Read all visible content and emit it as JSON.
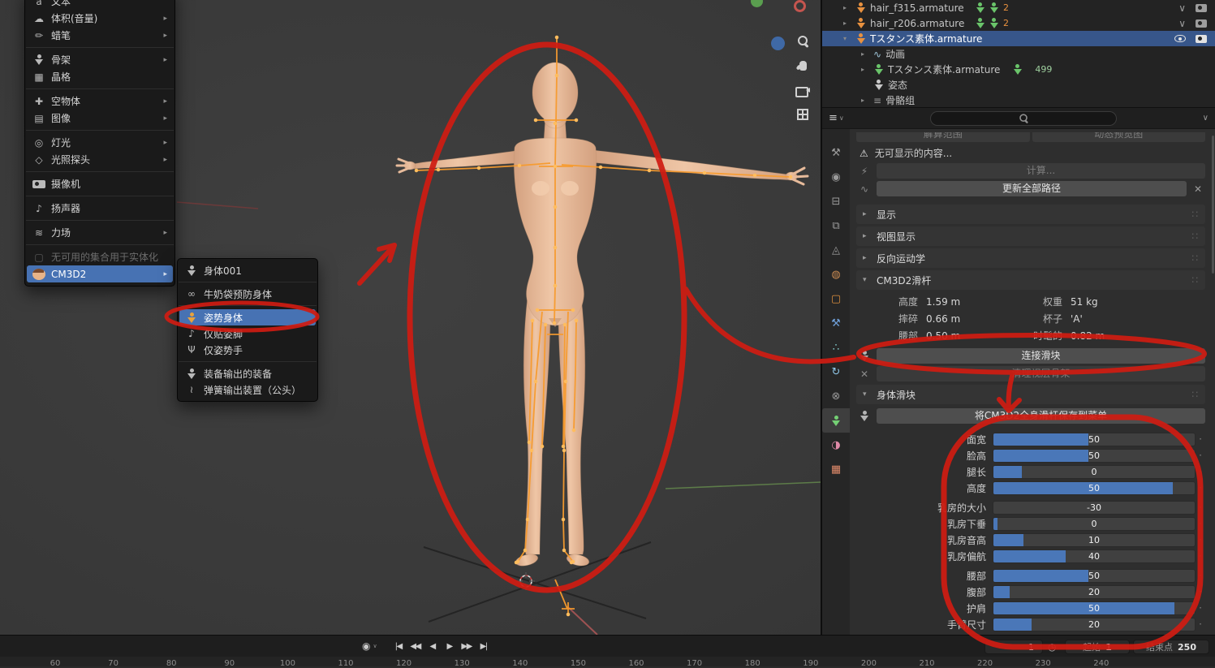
{
  "colors": {
    "accent": "#4772b3",
    "annotation": "#cf1c12",
    "armature": "#ffa133",
    "skin": "#eec3a4",
    "selected_row": "#37568a"
  },
  "add_menu": {
    "arrow_glyph": "▸",
    "items": [
      {
        "label": "文本",
        "icon": "text-icon",
        "glyph": "a"
      },
      {
        "label": "体积(音量)",
        "icon": "volume-icon",
        "glyph": "☁",
        "arrow": true
      },
      {
        "label": "蜡笔",
        "icon": "grease-pencil-icon",
        "glyph": "✏",
        "arrow": true,
        "sep": true
      },
      {
        "label": "骨架",
        "icon": "armature-icon",
        "glyph": "person",
        "arrow": true
      },
      {
        "label": "晶格",
        "icon": "lattice-icon",
        "glyph": "▦",
        "sep": true
      },
      {
        "label": "空物体",
        "icon": "empty-icon",
        "glyph": "✚",
        "arrow": true
      },
      {
        "label": "图像",
        "icon": "image-icon",
        "glyph": "▤",
        "arrow": true,
        "sep": true
      },
      {
        "label": "灯光",
        "icon": "light-icon",
        "glyph": "◎",
        "arrow": true
      },
      {
        "label": "光照探头",
        "icon": "light-probe-icon",
        "glyph": "◇",
        "arrow": true,
        "sep": true
      },
      {
        "label": "摄像机",
        "icon": "camera-icon",
        "glyph": "camera",
        "sep": true
      },
      {
        "label": "扬声器",
        "icon": "speaker-icon",
        "glyph": "♪",
        "sep": true
      },
      {
        "label": "力场",
        "icon": "force-field-icon",
        "glyph": "≋",
        "arrow": true,
        "sep": true
      },
      {
        "label": "无可用的集合用于实体化",
        "icon": "collection-icon",
        "glyph": "▢",
        "disabled": true
      },
      {
        "label": "CM3D2",
        "icon": "cm3d2-icon",
        "glyph": "face",
        "arrow": true,
        "highlighted": true
      }
    ]
  },
  "cm3d2_submenu": {
    "items": [
      {
        "label": "身体001",
        "icon": "body-icon",
        "glyph": "person",
        "sep": true
      },
      {
        "label": "牛奶袋预防身体",
        "icon": "milk-bag-body-icon",
        "glyph": "∞",
        "sep": true
      },
      {
        "label": "姿势身体",
        "icon": "pose-body-icon",
        "glyph": "person",
        "icon_color": "#e8a33d",
        "highlighted": true
      },
      {
        "label": "仅贴姿脚",
        "icon": "pose-feet-icon",
        "glyph": "♪"
      },
      {
        "label": "仅姿势手",
        "icon": "pose-hands-icon",
        "glyph": "Ψ",
        "sep": true
      },
      {
        "label": "装备输出的装备",
        "icon": "equipment-icon",
        "glyph": "person"
      },
      {
        "label": "弹簧输出装置（公头）",
        "icon": "spring-plug-icon",
        "glyph": "≀"
      }
    ]
  },
  "outliner": {
    "rows": [
      {
        "label": "hair_f315.armature",
        "caret": "▸",
        "icon": "armature",
        "mods": [
          "person",
          "person"
        ],
        "badge": "2",
        "right": [
          "chevron",
          "camera"
        ]
      },
      {
        "label": "hair_r206.armature",
        "caret": "▸",
        "icon": "armature",
        "mods": [
          "person",
          "person"
        ],
        "badge": "2",
        "right": [
          "chevron",
          "camera"
        ]
      },
      {
        "label": "Tスタンス素体.armature",
        "caret": "▾",
        "icon": "armature",
        "selected": true,
        "right": [
          "eye",
          "camera"
        ]
      },
      {
        "label": "动画",
        "caret": "▸",
        "icon": "anim",
        "indent": 1
      },
      {
        "label": "Tスタンス素体.armature",
        "caret": "▸",
        "icon": "person-green",
        "indent": 1,
        "count": "499"
      },
      {
        "label": "姿态",
        "caret": "",
        "icon": "pose",
        "indent": 1
      },
      {
        "label": "骨骼组",
        "caret": "▸",
        "icon": "group",
        "indent": 1
      }
    ]
  },
  "properties": {
    "header": {
      "editor_glyph": "≡",
      "chevron": "∨"
    },
    "icons": {
      "warning": "⚠",
      "calc": "⚡",
      "update": "∿",
      "close": "✕",
      "dots": "∷",
      "caret_closed": "▸",
      "caret_open": "▾",
      "connect": "person",
      "clean": "✕",
      "save": "person"
    },
    "range_left": "解算范围",
    "range_right": "动态预览图",
    "warning": "无可显示的内容...",
    "calc": "计算...",
    "update": "更新全部路径",
    "panel_display": "显示",
    "panel_viewport": "视图显示",
    "panel_ik": "反向运动学",
    "panel_cm3d2": "CM3D2滑杆",
    "panel_body": "身体滑块",
    "stats": {
      "r1l": "高度",
      "r1v": "1.59 m",
      "r1l2": "权重",
      "r1v2": "51 kg",
      "r2l": "摔碎",
      "r2v": "0.66 m",
      "r2l2": "杯子",
      "r2v2": "'A'",
      "r3l": "腰部",
      "r3v": "0.50 m",
      "r3l2": "时髦的",
      "r3v2": "0.82 m"
    },
    "connect": "连接滑块",
    "clean": "清理视层骨架",
    "save": "将CM3D2全身滑杆保存到菜单",
    "tabs": [
      {
        "name": "tool",
        "glyph": "⚒",
        "color": "#9a9a9a"
      },
      {
        "name": "render",
        "glyph": "◉",
        "color": "#9a9a9a"
      },
      {
        "name": "output",
        "glyph": "⊟",
        "color": "#9a9a9a"
      },
      {
        "name": "view-layer",
        "glyph": "⧉",
        "color": "#9a9a9a"
      },
      {
        "name": "scene",
        "glyph": "◬",
        "color": "#9a9a9a"
      },
      {
        "name": "world",
        "glyph": "◍",
        "color": "#c98a52"
      },
      {
        "name": "object",
        "glyph": "▢",
        "color": "#dd8f3e"
      },
      {
        "name": "modifiers",
        "glyph": "⚒",
        "color": "#6f9fd8"
      },
      {
        "name": "particles",
        "glyph": "∴",
        "color": "#84cfd0"
      },
      {
        "name": "physics",
        "glyph": "↻",
        "color": "#8fc7e8"
      },
      {
        "name": "constraints",
        "glyph": "⊗",
        "color": "#9a9a9a"
      },
      {
        "name": "data",
        "glyph": "person",
        "color": "#74d074",
        "active": true
      },
      {
        "name": "material",
        "glyph": "◑",
        "color": "#e089a8"
      },
      {
        "name": "texture",
        "glyph": "▦",
        "color": "#e08a6a"
      }
    ],
    "sliders": [
      {
        "label": "面宽",
        "value": "50",
        "fill": 47
      },
      {
        "label": "脸高",
        "value": "50",
        "fill": 47
      },
      {
        "label": "腿长",
        "value": "0",
        "fill": 14
      },
      {
        "label": "高度",
        "value": "50",
        "fill": 89
      },
      {
        "label": "乳房的大小",
        "value": "-30",
        "fill": 0,
        "gap": true
      },
      {
        "label": "乳房下垂",
        "value": "0",
        "fill": 2
      },
      {
        "label": "乳房音高",
        "value": "10",
        "fill": 15
      },
      {
        "label": "乳房偏航",
        "value": "40",
        "fill": 36
      },
      {
        "label": "腰部",
        "value": "50",
        "fill": 47,
        "gap": true
      },
      {
        "label": "腹部",
        "value": "20",
        "fill": 8
      },
      {
        "label": "护肩",
        "value": "50",
        "fill": 90
      },
      {
        "label": "手臂尺寸",
        "value": "20",
        "fill": 19
      }
    ]
  },
  "timeline": {
    "frame": "1",
    "start_label": "起始",
    "start_value": "1",
    "end_label": "结束点",
    "end_value": "250",
    "record_glyph": "◉",
    "clock_glyph": "◷",
    "transport": [
      "|◀",
      "◀◀",
      "◀",
      "▶",
      "▶▶",
      "▶|"
    ],
    "transport_names": [
      "jump-to-start-button",
      "prev-keyframe-button",
      "play-reverse-button",
      "play-button",
      "next-keyframe-button",
      "jump-to-end-button"
    ],
    "ruler": [
      60,
      70,
      80,
      90,
      100,
      110,
      120,
      130,
      140,
      150,
      160,
      170,
      180,
      190,
      200,
      210,
      220,
      230,
      240
    ]
  }
}
